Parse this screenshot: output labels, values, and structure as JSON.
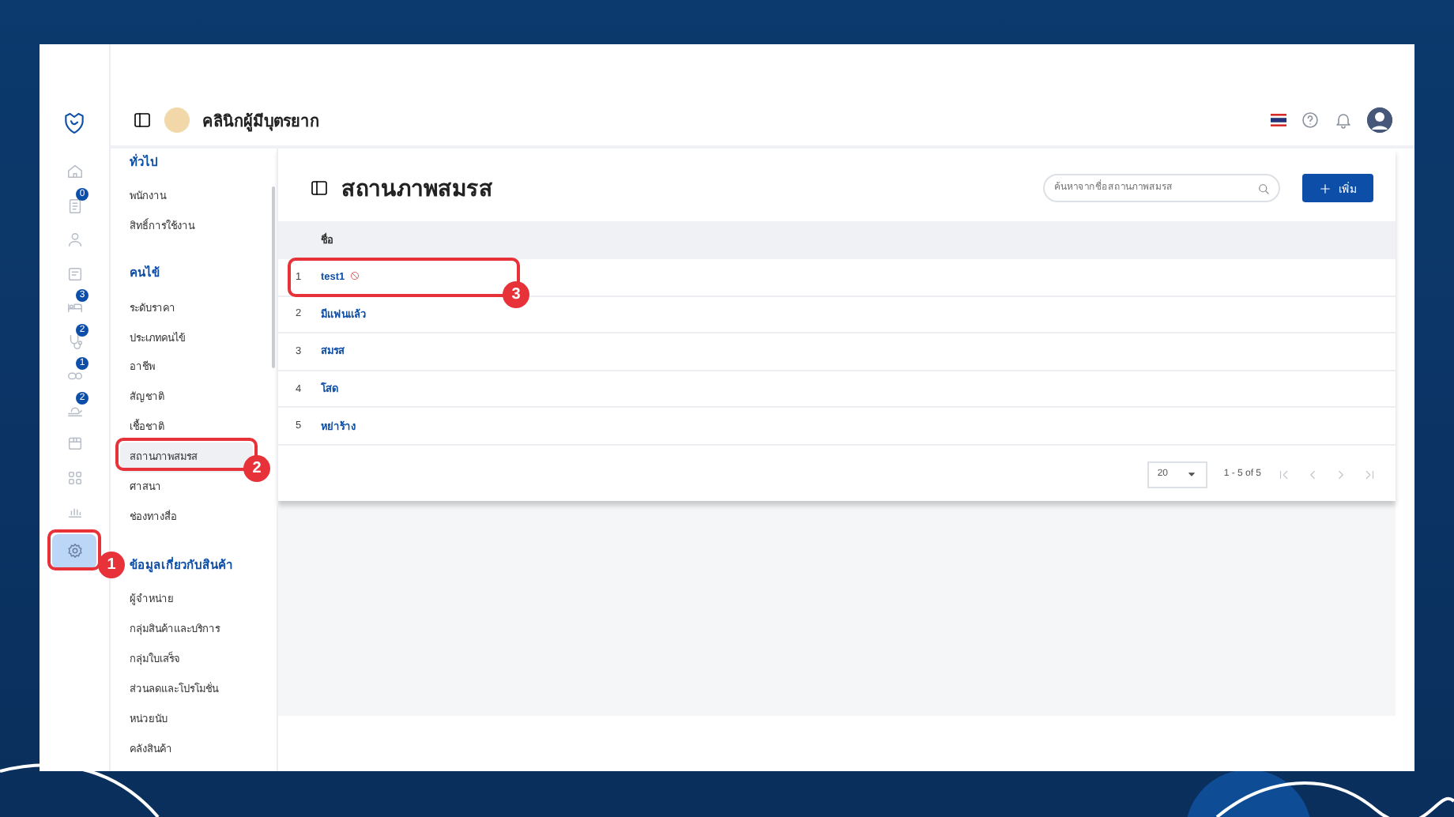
{
  "header": {
    "clinic_name": "คลินิกผู้มีบุตรยาก"
  },
  "rail": [
    {
      "selected": false
    },
    {
      "badge": "0",
      "selected": false
    },
    {
      "selected": false
    },
    {
      "selected": false
    },
    {
      "badge": "3",
      "selected": false
    },
    {
      "badge": "2",
      "selected": false
    },
    {
      "badge": "1",
      "selected": false
    },
    {
      "badge": "2",
      "selected": false
    },
    {
      "selected": false
    },
    {
      "selected": false
    },
    {
      "selected": false
    },
    {
      "selected": true,
      "annotation": "1"
    }
  ],
  "submenu": [
    {
      "heading": "ทั่วไป",
      "items": [
        {
          "label": "พนักงาน",
          "selected": false
        },
        {
          "label": "สิทธิ์การใช้งาน",
          "selected": false
        }
      ]
    },
    {
      "heading": "คนไข้",
      "items": [
        {
          "label": "ระดับราคา",
          "selected": false
        },
        {
          "label": "ประเภทคนไข้",
          "selected": false
        },
        {
          "label": "อาชีพ",
          "selected": false
        },
        {
          "label": "สัญชาติ",
          "selected": false
        },
        {
          "label": "เชื้อชาติ",
          "selected": false
        },
        {
          "label": "สถานภาพสมรส",
          "selected": true,
          "annotation": "2"
        },
        {
          "label": "ศาสนา",
          "selected": false
        },
        {
          "label": "ช่องทางสื่อ",
          "selected": false
        }
      ]
    },
    {
      "heading": "ข้อมูลเกี่ยวกับสินค้า",
      "items": [
        {
          "label": "ผู้จำหน่าย",
          "selected": false
        },
        {
          "label": "กลุ่มสินค้าและบริการ",
          "selected": false
        },
        {
          "label": "กลุ่มใบเสร็จ",
          "selected": false
        },
        {
          "label": "ส่วนลดและโปรโมชั่น",
          "selected": false
        },
        {
          "label": "หน่วยนับ",
          "selected": false
        },
        {
          "label": "คลังสินค้า",
          "selected": false
        }
      ]
    }
  ],
  "page": {
    "title": "สถานภาพสมรส",
    "search": {
      "placeholder": "ค้นหาจากชื่อสถานภาพสมรส"
    },
    "add_button": "เพิ่ม"
  },
  "table": {
    "columns": [
      "ชื่อ"
    ],
    "rows": [
      {
        "index": "1",
        "name": "test1",
        "inactive": true,
        "annotation": "3"
      },
      {
        "index": "2",
        "name": "มีแฟนแล้ว",
        "inactive": false
      },
      {
        "index": "3",
        "name": "สมรส",
        "inactive": false
      },
      {
        "index": "4",
        "name": "โสด",
        "inactive": false
      },
      {
        "index": "5",
        "name": "หย่าร้าง",
        "inactive": false
      }
    ]
  },
  "pagination": {
    "page_size": "20",
    "range": "1 - 5 of 5"
  }
}
